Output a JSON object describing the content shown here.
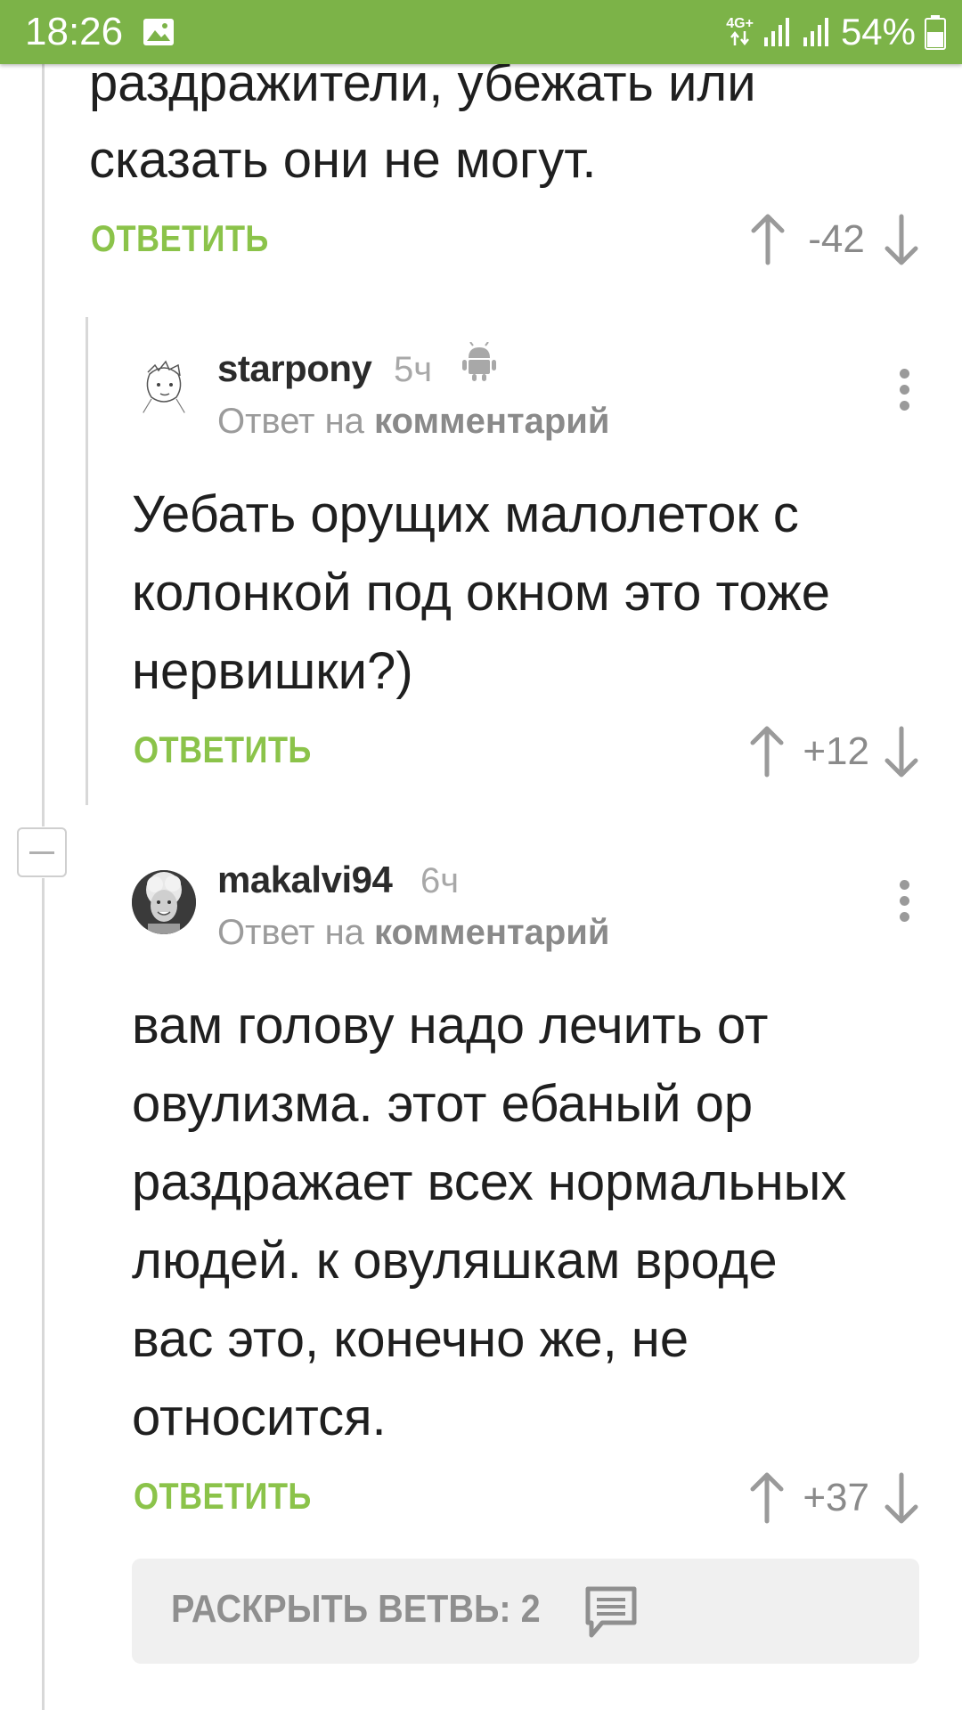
{
  "status_bar": {
    "time": "18:26",
    "network": "4G+",
    "battery": "54%",
    "icons": [
      "image-icon",
      "signal-icon",
      "signal-icon",
      "battery-icon"
    ]
  },
  "top_comment": {
    "text_lines": [
      "раздражители, убежать или",
      "сказать они не могут."
    ],
    "reply_label": "ОТВЕТИТЬ",
    "score": "-42"
  },
  "comment_1": {
    "username": "starpony",
    "time_ago": "5ч",
    "reply_to_prefix": "Ответ на",
    "reply_to_target": "комментарий",
    "text_lines": [
      "Уебать орущих малолеток с",
      "колонкой под окном это тоже",
      "нервишки?)"
    ],
    "reply_label": "ОТВЕТИТЬ",
    "score": "+12",
    "platform_icon": "android-icon"
  },
  "comment_2": {
    "username": "makalvi94",
    "time_ago": "6ч",
    "reply_to_prefix": "Ответ на",
    "reply_to_target": "комментарий",
    "text_lines": [
      "вам голову надо лечить от",
      "овулизма. этот ебаный ор",
      "раздражает всех нормальных",
      "людей. к овуляшкам вроде",
      "вас это, конечно же, не",
      "относится."
    ],
    "reply_label": "ОТВЕТИТЬ",
    "score": "+37"
  },
  "expand_branch": {
    "label": "РАСКРЫТЬ ВЕТВЬ: 2",
    "icon": "comment-icon"
  },
  "colors": {
    "accent": "#7cb348",
    "reply": "#8bc34a",
    "muted": "#9b9b9b"
  }
}
